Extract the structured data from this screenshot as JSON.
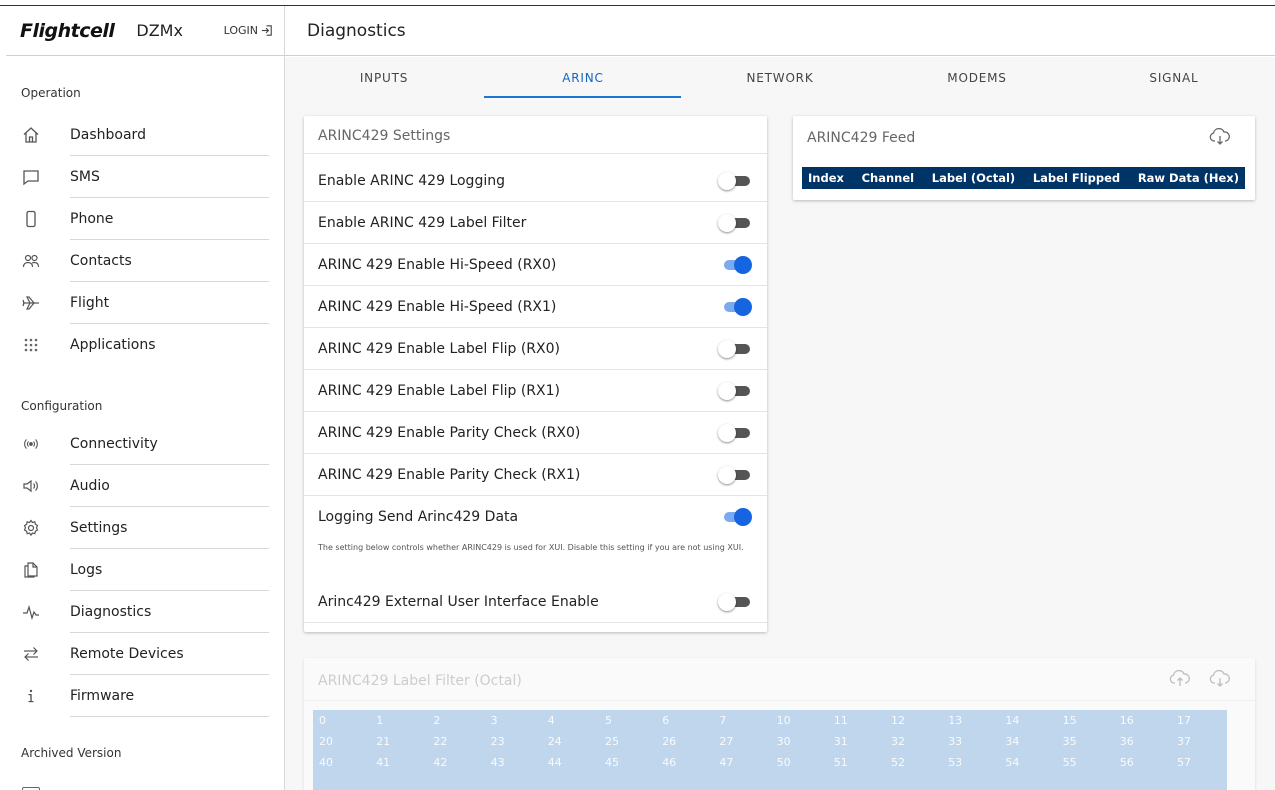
{
  "app": {
    "logo": "Flightcell",
    "product": "DZMx",
    "login_label": "LOGIN"
  },
  "page_title": "Diagnostics",
  "sidebar": {
    "operation_label": "Operation",
    "operation_items": [
      {
        "label": "Dashboard",
        "icon": "home-icon"
      },
      {
        "label": "SMS",
        "icon": "chat-icon"
      },
      {
        "label": "Phone",
        "icon": "phone-icon"
      },
      {
        "label": "Contacts",
        "icon": "contacts-icon"
      },
      {
        "label": "Flight",
        "icon": "airplane-icon"
      },
      {
        "label": "Applications",
        "icon": "apps-grid-icon"
      }
    ],
    "configuration_label": "Configuration",
    "configuration_items": [
      {
        "label": "Connectivity",
        "icon": "broadcast-icon"
      },
      {
        "label": "Audio",
        "icon": "speaker-icon"
      },
      {
        "label": "Settings",
        "icon": "gear-icon"
      },
      {
        "label": "Logs",
        "icon": "documents-icon"
      },
      {
        "label": "Diagnostics",
        "icon": "pulse-icon"
      },
      {
        "label": "Remote Devices",
        "icon": "swap-arrows-icon"
      },
      {
        "label": "Firmware",
        "icon": "info-icon"
      }
    ],
    "archived_label": "Archived Version"
  },
  "tabs": {
    "items": [
      "INPUTS",
      "ARINC",
      "NETWORK",
      "MODEMS",
      "SIGNAL"
    ],
    "active": "ARINC"
  },
  "settings": {
    "title": "ARINC429 Settings",
    "rows": [
      {
        "label": "Enable ARINC 429 Logging",
        "on": false
      },
      {
        "label": "Enable ARINC 429 Label Filter",
        "on": false
      },
      {
        "label": "ARINC 429 Enable Hi-Speed (RX0)",
        "on": true
      },
      {
        "label": "ARINC 429 Enable Hi-Speed (RX1)",
        "on": true
      },
      {
        "label": "ARINC 429 Enable Label Flip (RX0)",
        "on": false
      },
      {
        "label": "ARINC 429 Enable Label Flip (RX1)",
        "on": false
      },
      {
        "label": "ARINC 429 Enable Parity Check (RX0)",
        "on": false
      },
      {
        "label": "ARINC 429 Enable Parity Check (RX1)",
        "on": false
      },
      {
        "label": "Logging Send Arinc429 Data",
        "on": true
      },
      {
        "label": "Arinc429 External User Interface Enable",
        "on": false
      }
    ],
    "help_text": "The setting below controls whether ARINC429 is used for XUI. Disable this setting if you are not using XUI."
  },
  "feed": {
    "title": "ARINC429 Feed",
    "columns": [
      "Index",
      "Channel",
      "Label (Octal)",
      "Label Flipped",
      "Raw Data (Hex)"
    ]
  },
  "label_filter": {
    "title": "ARINC429 Label Filter (Octal)",
    "rows": [
      [
        "0",
        "1",
        "2",
        "3",
        "4",
        "5",
        "6",
        "7",
        "10",
        "11",
        "12",
        "13",
        "14",
        "15",
        "16",
        "17"
      ],
      [
        "20",
        "21",
        "22",
        "23",
        "24",
        "25",
        "26",
        "27",
        "30",
        "31",
        "32",
        "33",
        "34",
        "35",
        "36",
        "37"
      ],
      [
        "40",
        "41",
        "42",
        "43",
        "44",
        "45",
        "46",
        "47",
        "50",
        "51",
        "52",
        "53",
        "54",
        "55",
        "56",
        "57"
      ]
    ]
  },
  "colors": {
    "accent": "#1976d2",
    "toggle_on": "#1565e0",
    "feed_header": "#003366"
  }
}
